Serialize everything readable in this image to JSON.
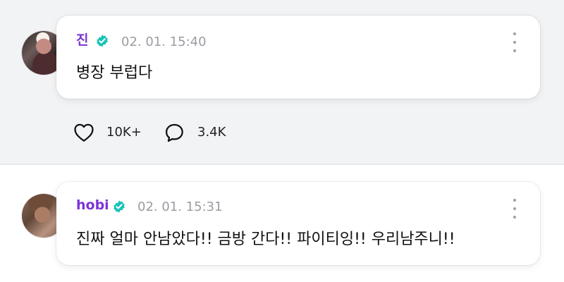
{
  "comments": [
    {
      "username": "진",
      "timestamp": "02. 01. 15:40",
      "text": "병장 부럽다",
      "verified": true,
      "avatar_icon": "profile-photo-avatar",
      "name_color": "#7b34d7",
      "verified_color": "#19c2b7",
      "likes": "10K+",
      "replies": "3.4K"
    },
    {
      "username": "hobi",
      "timestamp": "02. 01. 15:31",
      "text": "진짜 얼마 안남았다!! 금방 간다!! 파이티잉!! 우리남주니!!",
      "verified": true,
      "avatar_icon": "profile-photo-avatar",
      "name_color": "#7b34d7",
      "verified_color": "#19c2b7"
    }
  ],
  "icons": {
    "verified": "verified-badge-icon",
    "more": "more-vertical-icon",
    "like": "heart-icon",
    "reply": "speech-bubble-icon"
  },
  "colors": {
    "top_background": "#f2f3f5",
    "card_background": "#ffffff",
    "muted_text": "#9b9ba3",
    "body_text": "#111111"
  }
}
